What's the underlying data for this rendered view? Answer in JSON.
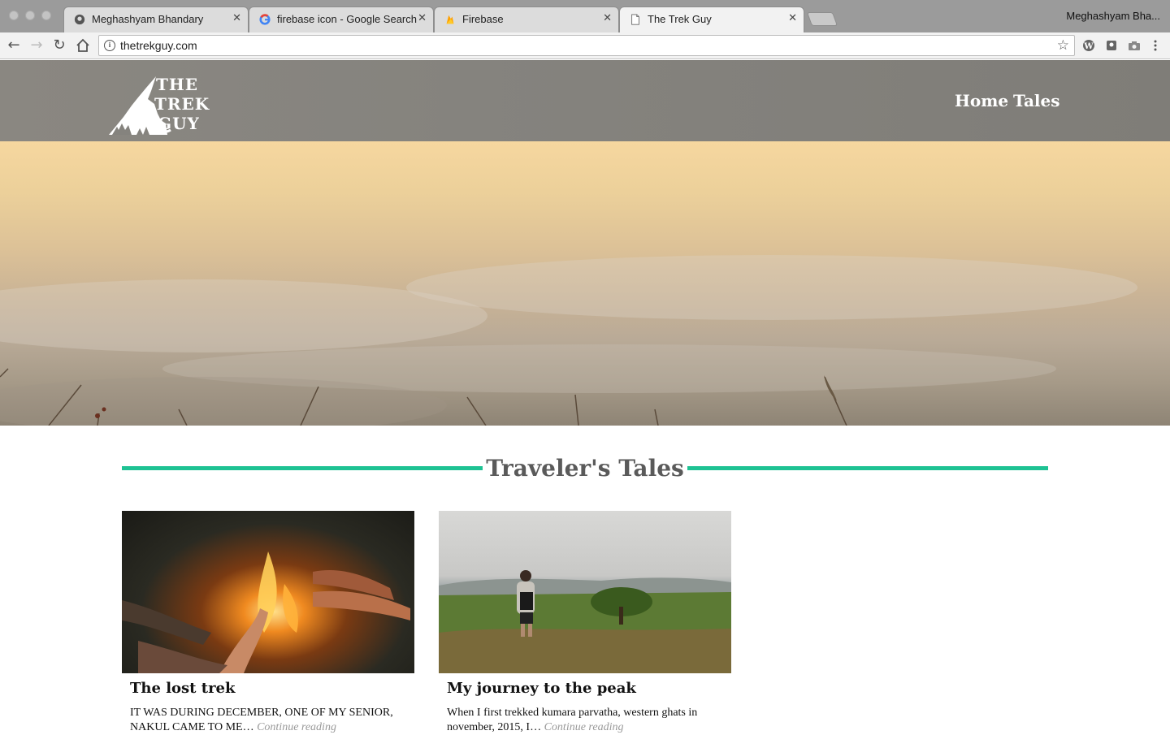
{
  "browser": {
    "tabs": [
      {
        "title": "Meghashyam Bhandary",
        "icon": "github-icon"
      },
      {
        "title": "firebase icon - Google Search",
        "icon": "google-icon"
      },
      {
        "title": "Firebase",
        "icon": "firebase-icon"
      },
      {
        "title": "The Trek Guy",
        "icon": "page-icon"
      }
    ],
    "active_tab": 3,
    "profile_name": "Meghashyam Bha...",
    "url": "thetrekguy.com",
    "extensions": [
      "wordpress-icon",
      "extension-icon",
      "camera-icon",
      "menu-icon"
    ]
  },
  "site": {
    "logo_lines": [
      "THE",
      "TREK",
      "GUY"
    ],
    "nav": [
      {
        "label": "Home"
      },
      {
        "label": "Tales"
      }
    ],
    "accent_color": "#1ec293"
  },
  "section": {
    "title": "Traveler's Tales"
  },
  "posts": [
    {
      "title": "The lost trek",
      "excerpt": "IT WAS DURING DECEMBER, ONE OF MY SENIOR, NAKUL CAME TO ME…",
      "more": "Continue reading",
      "image": "campfire-photo"
    },
    {
      "title": "My journey to the peak",
      "excerpt": "When I first trekked kumara parvatha, western ghats in november, 2015, I…",
      "more": "Continue reading",
      "image": "mountain-view-photo"
    }
  ]
}
